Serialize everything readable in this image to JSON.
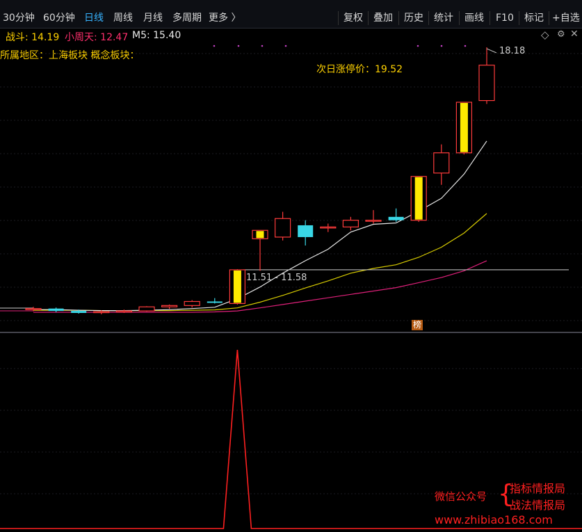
{
  "toolbar": {
    "left_tabs": [
      {
        "label": "30分钟",
        "active": false
      },
      {
        "label": "60分钟",
        "active": false
      },
      {
        "label": "日线",
        "active": true
      },
      {
        "label": "周线",
        "active": false
      },
      {
        "label": "月线",
        "active": false
      },
      {
        "label": "多周期",
        "active": false
      },
      {
        "label": "更多 〉",
        "active": false
      }
    ],
    "right_buttons": [
      "复权",
      "叠加",
      "历史",
      "统计",
      "画线",
      "F10",
      "标记",
      "+自选"
    ]
  },
  "indicators": {
    "zhandou": {
      "label": "战斗: 14.19",
      "color": "#ffd200"
    },
    "xiaozhoutian": {
      "label": "小周天: 12.47",
      "color": "#ff2f6d"
    },
    "m5": {
      "label": "M5: 15.40",
      "color": "#e8e8e8"
    }
  },
  "region_line": "所属地区：上海板块   概念板块：",
  "limit_price": "次日涨停价：19.52",
  "peak_label": "18.18",
  "range_label": "11.51 - 11.58",
  "bang_badge": "榜",
  "watermark": {
    "wechat": "微信公众号",
    "line1": "指标情报局",
    "line2": "战法情报局",
    "site": "www.zhibiao168.com"
  },
  "colors": {
    "up": "#ff3b3b",
    "down": "#39d7e6",
    "limit": "#ffea00",
    "ma_white": "#e8e8e8",
    "ma_yellow": "#d8cc00",
    "ma_pink": "#e0207a"
  },
  "chart_data": {
    "type": "candlestick",
    "candles": [
      {
        "o": 10.4,
        "h": 10.48,
        "l": 10.35,
        "c": 10.43
      },
      {
        "o": 10.43,
        "h": 10.46,
        "l": 10.32,
        "c": 10.36
      },
      {
        "o": 10.36,
        "h": 10.4,
        "l": 10.28,
        "c": 10.3
      },
      {
        "o": 10.32,
        "h": 10.38,
        "l": 10.26,
        "c": 10.34
      },
      {
        "o": 10.34,
        "h": 10.4,
        "l": 10.3,
        "c": 10.36
      },
      {
        "o": 10.36,
        "h": 10.5,
        "l": 10.34,
        "c": 10.48
      },
      {
        "o": 10.48,
        "h": 10.55,
        "l": 10.42,
        "c": 10.52
      },
      {
        "o": 10.52,
        "h": 10.68,
        "l": 10.46,
        "c": 10.64
      },
      {
        "o": 10.64,
        "h": 10.74,
        "l": 10.58,
        "c": 10.6
      },
      {
        "o": 10.58,
        "h": 11.6,
        "l": 10.55,
        "c": 11.58
      },
      {
        "o": 12.5,
        "h": 12.6,
        "l": 11.55,
        "c": 12.75
      },
      {
        "o": 12.55,
        "h": 13.3,
        "l": 12.45,
        "c": 13.1
      },
      {
        "o": 12.9,
        "h": 13.05,
        "l": 12.3,
        "c": 12.55
      },
      {
        "o": 12.85,
        "h": 12.95,
        "l": 12.7,
        "c": 12.85
      },
      {
        "o": 12.85,
        "h": 13.15,
        "l": 12.75,
        "c": 13.05
      },
      {
        "o": 13.05,
        "h": 13.35,
        "l": 12.95,
        "c": 13.05
      },
      {
        "o": 13.15,
        "h": 13.4,
        "l": 13.0,
        "c": 13.05
      },
      {
        "o": 13.05,
        "h": 14.35,
        "l": 13.0,
        "c": 14.35
      },
      {
        "o": 14.45,
        "h": 15.3,
        "l": 14.1,
        "c": 15.05
      },
      {
        "o": 15.05,
        "h": 16.55,
        "l": 15.0,
        "c": 16.55
      },
      {
        "o": 16.6,
        "h": 18.18,
        "l": 16.5,
        "c": 17.65
      }
    ],
    "ma_white": [
      10.4,
      10.4,
      10.38,
      10.37,
      10.37,
      10.38,
      10.4,
      10.43,
      10.47,
      10.72,
      11.07,
      11.48,
      11.85,
      12.19,
      12.7,
      12.93,
      12.97,
      13.32,
      13.7,
      14.42,
      15.4
    ],
    "ma_yellow": [
      10.38,
      10.38,
      10.38,
      10.37,
      10.37,
      10.37,
      10.37,
      10.38,
      10.39,
      10.45,
      10.62,
      10.82,
      11.04,
      11.25,
      11.48,
      11.62,
      11.73,
      11.95,
      12.25,
      12.67,
      13.25
    ],
    "ma_pink": [
      10.32,
      10.32,
      10.32,
      10.32,
      10.32,
      10.32,
      10.32,
      10.32,
      10.33,
      10.36,
      10.45,
      10.55,
      10.65,
      10.75,
      10.85,
      10.95,
      11.05,
      11.2,
      11.35,
      11.55,
      11.85
    ],
    "limit_up_days": [
      9,
      10,
      17,
      19
    ],
    "signal": [
      0,
      0,
      0,
      0,
      0,
      0,
      0,
      0,
      0,
      1,
      0,
      0,
      0,
      0,
      0,
      0,
      0,
      0,
      0,
      0,
      0
    ]
  }
}
